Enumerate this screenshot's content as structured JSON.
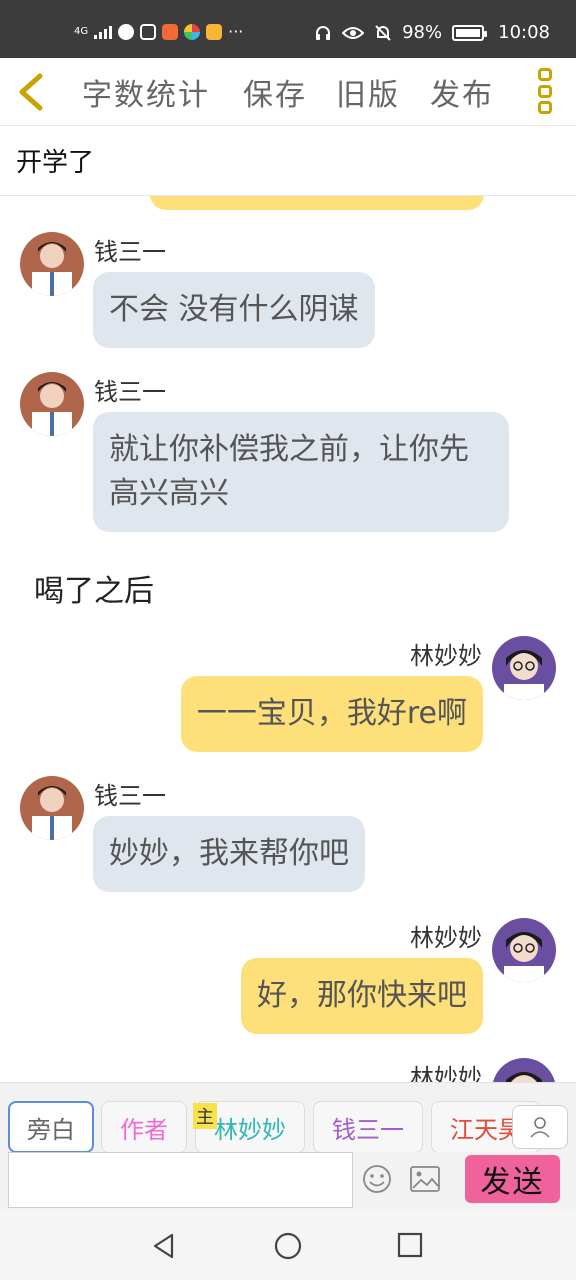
{
  "status_bar": {
    "network": "4G",
    "more": "···",
    "battery_percent": "98%",
    "battery_level": 0.98,
    "time": "10:08"
  },
  "nav": {
    "back_icon": "chevron-left-icon",
    "word_count": "字数统计",
    "save": "保存",
    "old_version": "旧版",
    "publish": "发布",
    "more_icon": "more-vertical-icon"
  },
  "title": "开学了",
  "messages": [
    {
      "type": "left",
      "name": "钱三一",
      "text": "不会 没有什么阴谋"
    },
    {
      "type": "left",
      "name": "钱三一",
      "text": "就让你补偿我之前，让你先高兴高兴"
    },
    {
      "type": "narration",
      "text": "喝了之后"
    },
    {
      "type": "right",
      "name": "林妙妙",
      "text": "一一宝贝，我好re啊"
    },
    {
      "type": "left",
      "name": "钱三一",
      "text": "妙妙，我来帮你吧"
    },
    {
      "type": "right",
      "name": "林妙妙",
      "text": "好，那你快来吧"
    },
    {
      "type": "right",
      "name": "林妙妙",
      "text": ""
    }
  ],
  "roles": [
    {
      "label": "旁白",
      "color": "#666666",
      "selected": true
    },
    {
      "label": "作者",
      "color": "#ef6ad6",
      "selected": false
    },
    {
      "label": "林妙妙",
      "color": "#2fb8b8",
      "selected": false,
      "badge": "主"
    },
    {
      "label": "钱三一",
      "color": "#a35cc8",
      "selected": false
    },
    {
      "label": "江天昊",
      "color": "#e34b3c",
      "selected": false
    }
  ],
  "input": {
    "value": "",
    "placeholder": ""
  },
  "send_label": "发送",
  "colors": {
    "accent": "#c9a300",
    "bubble_left": "#e0e6ee",
    "bubble_right": "#fde07a",
    "send": "#f0629c",
    "selected_border": "#5a8ed8"
  }
}
